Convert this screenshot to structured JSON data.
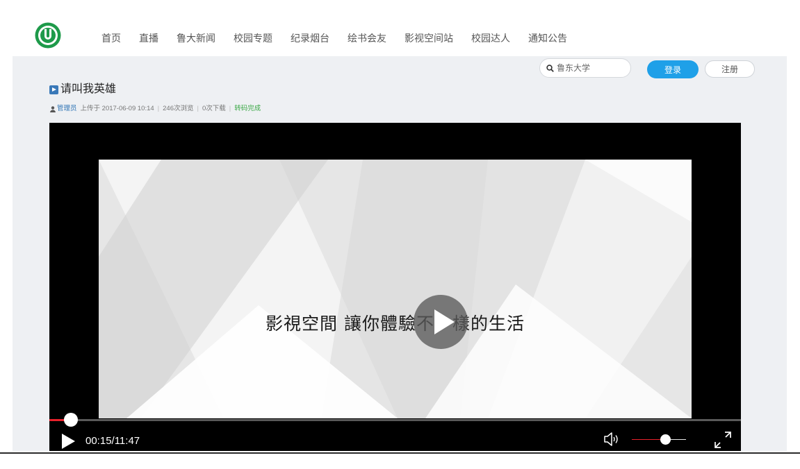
{
  "nav": {
    "items": [
      "首页",
      "直播",
      "鲁大新闻",
      "校园专题",
      "纪录烟台",
      "绘书会友",
      "影视空间站",
      "校园达人",
      "通知公告"
    ],
    "search_placeholder": "鲁东大学",
    "login_label": "登录",
    "register_label": "注册"
  },
  "video": {
    "title": "请叫我英雄",
    "uploader": "管理员",
    "upload_time": "上传于 2017-06-09 10:14",
    "views": "246次浏览",
    "downloads": "0次下载",
    "status": "转码完成"
  },
  "player": {
    "caption": "影視空間 讓你體驗不一樣的生活",
    "time": "00:15/11:47",
    "progress_fraction": 0.031,
    "volume_fraction": 0.62
  },
  "colors": {
    "accent": "#1fa0e8",
    "progress": "#e8212b",
    "logo": "#1e9a4a",
    "uploader_link": "#2f74b5",
    "status": "#3aa845"
  },
  "icons": [
    "logo-icon",
    "search-icon",
    "video-icon",
    "user-icon",
    "play-icon",
    "volume-icon",
    "fullscreen-icon"
  ]
}
